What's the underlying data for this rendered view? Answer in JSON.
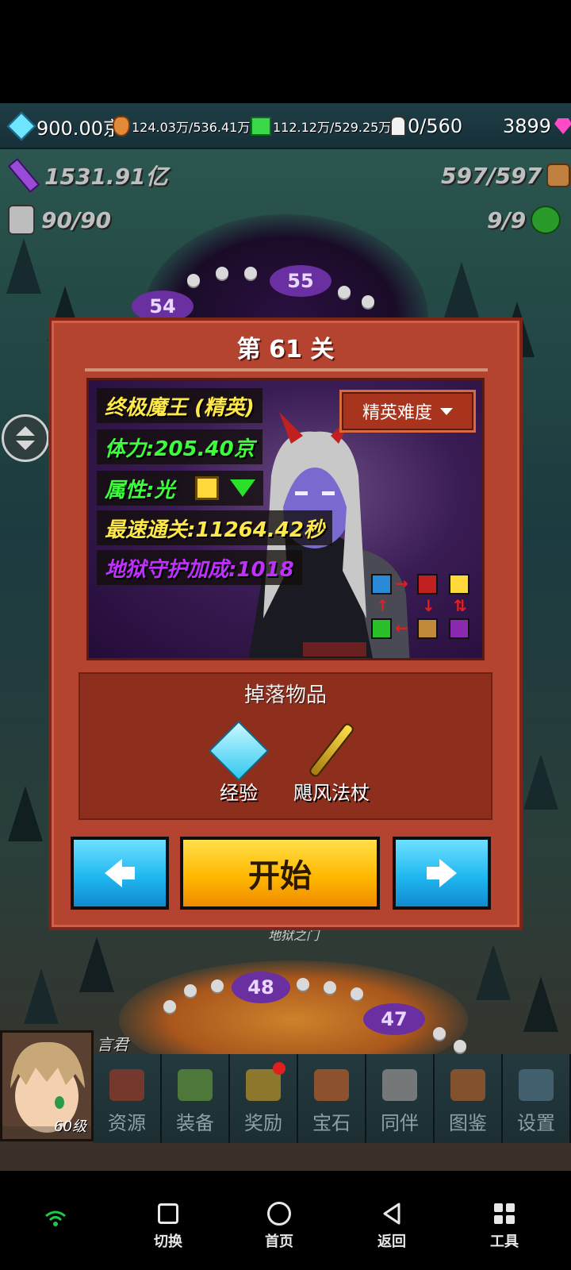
{
  "resources": {
    "crystal": "900.00京",
    "meat": "124.03万/536.41万",
    "gem_green": "112.12万/529.25万",
    "population": "0/560",
    "diamond": "3899"
  },
  "stats": {
    "sword": "1531.91亿",
    "bag": "597/597",
    "potion": "90/90",
    "bush": "9/9"
  },
  "map_nodes": {
    "n55": "55",
    "n54": "54",
    "n48": "48",
    "n47": "47"
  },
  "map_label": "地狱之门",
  "dialog": {
    "title": "第 61 关",
    "boss_name": "终极魔王 (精英)",
    "hp": "体力:205.40京",
    "attribute": "属性:光",
    "best_time": "最速通关:11264.42秒",
    "hell_bonus": "地狱守护加成:1018",
    "difficulty": "精英难度",
    "drop_title": "掉落物品",
    "drops": [
      "经验",
      "飓风法杖"
    ],
    "start": "开始"
  },
  "character": {
    "name": "言君",
    "level": "60级"
  },
  "menu": [
    "资源",
    "装备",
    "奖励",
    "宝石",
    "同伴",
    "图鉴",
    "设置"
  ],
  "nav": [
    "切换",
    "首页",
    "返回",
    "工具"
  ],
  "colors": {
    "hp": "#3cff3c",
    "name": "#ffe94a",
    "bonus": "#c030ff",
    "start": "#ffb800",
    "arrow_btn": "#20b8f0"
  }
}
